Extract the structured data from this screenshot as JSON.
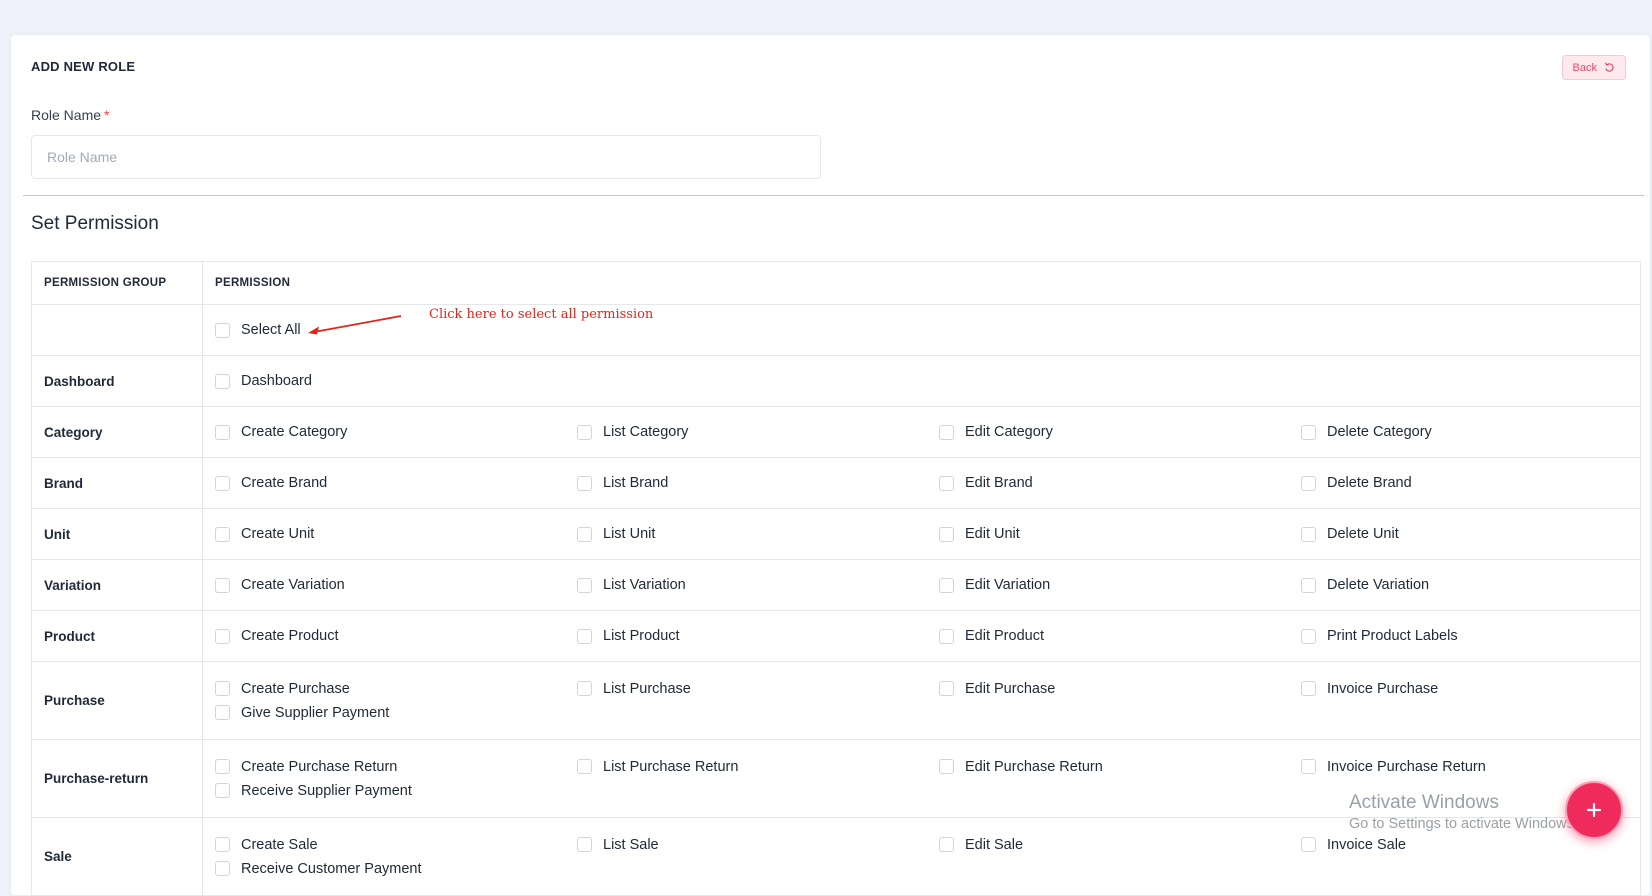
{
  "header": {
    "title": "ADD NEW ROLE",
    "back_label": "Back"
  },
  "form": {
    "role_name_label": "Role Name",
    "required_mark": "*",
    "role_name_placeholder": "Role Name",
    "role_name_value": ""
  },
  "permissions": {
    "section_title": "Set Permission",
    "column_headers": [
      "PERMISSION GROUP",
      "PERMISSION"
    ],
    "select_all_label": "Select All",
    "annotation": "Click here to select all permission",
    "annotation_color": "#e0251b",
    "groups": [
      {
        "name": "Dashboard",
        "items": [
          "Dashboard"
        ]
      },
      {
        "name": "Category",
        "items": [
          "Create Category",
          "List Category",
          "Edit Category",
          "Delete Category"
        ]
      },
      {
        "name": "Brand",
        "items": [
          "Create Brand",
          "List Brand",
          "Edit Brand",
          "Delete Brand"
        ]
      },
      {
        "name": "Unit",
        "items": [
          "Create Unit",
          "List Unit",
          "Edit Unit",
          "Delete Unit"
        ]
      },
      {
        "name": "Variation",
        "items": [
          "Create Variation",
          "List Variation",
          "Edit Variation",
          "Delete Variation"
        ]
      },
      {
        "name": "Product",
        "items": [
          "Create Product",
          "List Product",
          "Edit Product",
          "Print Product Labels"
        ]
      },
      {
        "name": "Purchase",
        "items": [
          "Create Purchase",
          "List Purchase",
          "Edit Purchase",
          "Invoice Purchase",
          "Give Supplier Payment"
        ]
      },
      {
        "name": "Purchase-return",
        "items": [
          "Create Purchase Return",
          "List Purchase Return",
          "Edit Purchase Return",
          "Invoice Purchase Return",
          "Receive Supplier Payment"
        ]
      },
      {
        "name": "Sale",
        "items": [
          "Create Sale",
          "List Sale",
          "Edit Sale",
          "Invoice Sale",
          "Receive Customer Payment"
        ]
      }
    ]
  },
  "watermark": {
    "line1": "Activate Windows",
    "line2": "Go to Settings to activate Windows."
  },
  "fab": {
    "icon": "plus-icon",
    "color": "#ef2b5d"
  },
  "colors": {
    "accent": "#ef2b5d",
    "back_button_text": "#e84a6f",
    "back_button_bg": "#fde9ee",
    "background": "#eef1f9"
  }
}
